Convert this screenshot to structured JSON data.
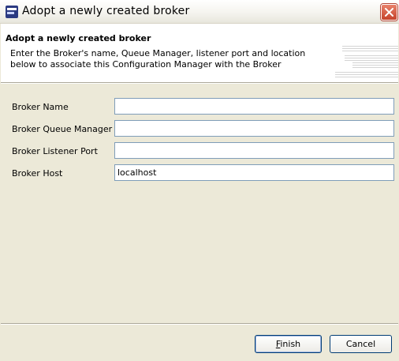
{
  "window": {
    "title": "Adopt a newly created broker"
  },
  "header": {
    "title": "Adopt a newly created broker",
    "description": "Enter the Broker's name, Queue Manager, listener port and location below to associate this Configuration Manager with the Broker"
  },
  "form": {
    "fields": [
      {
        "label": "Broker Name",
        "value": ""
      },
      {
        "label": "Broker Queue Manager",
        "value": ""
      },
      {
        "label": "Broker Listener Port",
        "value": ""
      },
      {
        "label": "Broker Host",
        "value": "localhost"
      }
    ]
  },
  "buttons": {
    "finish": "Finish",
    "cancel": "Cancel"
  },
  "colors": {
    "title_bar": "#f5f4ef",
    "dialog_background": "#ece9d8",
    "close_button": "#d6563e",
    "field_border": "#7f9db9",
    "button_border": "#003c74"
  },
  "icons": {
    "app": "app-icon",
    "close": "close-icon",
    "banner": "wizard-banner-graphic"
  }
}
